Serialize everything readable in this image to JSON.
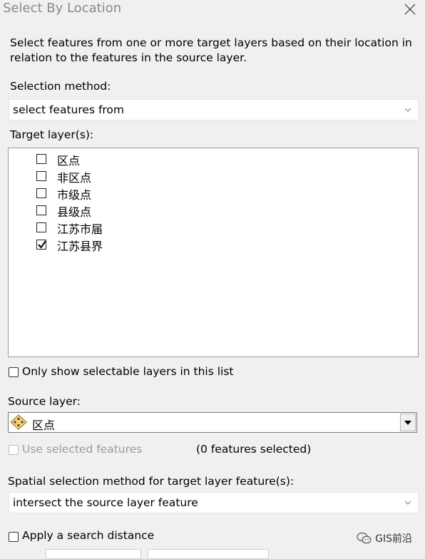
{
  "window": {
    "title": "Select By Location"
  },
  "description": "Select features from one or more target layers based on their location in relation to the features in the source layer.",
  "selection_method": {
    "label": "Selection method:",
    "value": "select features from"
  },
  "target_layers": {
    "label": "Target layer(s):",
    "items": [
      {
        "label": "区点",
        "checked": false
      },
      {
        "label": "非区点",
        "checked": false
      },
      {
        "label": "市级点",
        "checked": false
      },
      {
        "label": "县级点",
        "checked": false
      },
      {
        "label": "江苏市届",
        "checked": false
      },
      {
        "label": "江苏县界",
        "checked": true
      }
    ]
  },
  "only_selectable": {
    "label": "Only show selectable layers in this list",
    "checked": false
  },
  "source_layer": {
    "label": "Source layer:",
    "value": "区点"
  },
  "use_selected": {
    "label": "Use selected features",
    "enabled": false,
    "count_text": "(0 features selected)"
  },
  "spatial_method": {
    "label": "Spatial selection method for target layer feature(s):",
    "value": "intersect the source layer feature"
  },
  "search_distance": {
    "label": "Apply a search distance"
  },
  "watermark": {
    "text": "GIS前沿"
  },
  "colors": {
    "background": "#f0f0f0",
    "title_text": "#8a8a8a",
    "disabled_text": "#9c9c9c",
    "point_icon": "#f4d27a"
  }
}
